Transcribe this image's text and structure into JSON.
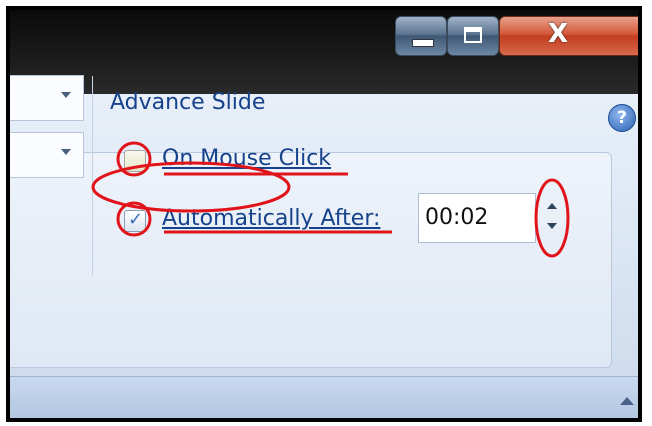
{
  "window": {
    "minimize_icon": "minimize-icon",
    "maximize_icon": "maximize-icon",
    "close_label": "X"
  },
  "ribbon": {
    "help_label": "?",
    "advance_slide": {
      "title": "Advance Slide",
      "on_mouse_click_label": "On Mouse Click",
      "on_mouse_click_checked": false,
      "automatically_after_label": "Automatically After:",
      "automatically_after_checked": true,
      "time_value": "00:02"
    }
  },
  "colors": {
    "annotation": "#e0141a",
    "ribbon_text": "#15428b"
  }
}
